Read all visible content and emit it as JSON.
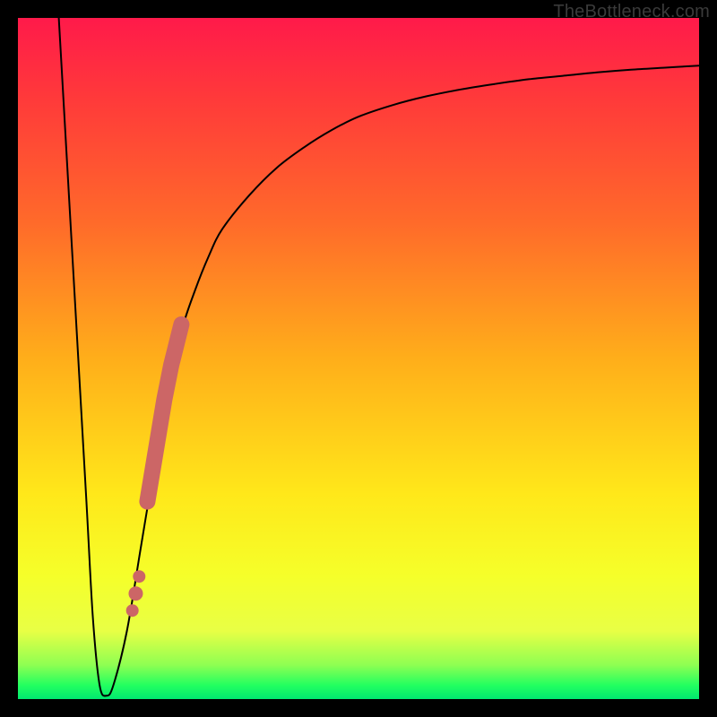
{
  "watermark": "TheBottleneck.com",
  "chart_data": {
    "type": "line",
    "title": "",
    "xlabel": "",
    "ylabel": "",
    "xlim": [
      0,
      100
    ],
    "ylim": [
      0,
      100
    ],
    "grid": false,
    "series": [
      {
        "name": "bottleneck-curve",
        "color": "#000000",
        "x": [
          6,
          8,
          10,
          11,
          12,
          13,
          14,
          16,
          18,
          20,
          22,
          24,
          26,
          28,
          30,
          34,
          38,
          42,
          46,
          50,
          55,
          60,
          65,
          70,
          75,
          80,
          85,
          90,
          95,
          100
        ],
        "y": [
          100,
          65,
          30,
          12,
          2,
          0.5,
          2,
          10,
          22,
          34,
          45,
          54,
          60,
          65,
          69,
          74,
          78,
          81,
          83.5,
          85.5,
          87.2,
          88.5,
          89.5,
          90.3,
          91,
          91.5,
          92,
          92.4,
          92.7,
          93
        ]
      }
    ],
    "overlay_marks": {
      "name": "highlight-segment",
      "color": "#cc6666",
      "x": [
        19.0,
        19.5,
        20.0,
        20.5,
        21.0,
        21.5,
        22.0,
        22.5,
        23.0,
        23.5,
        24.0,
        16.8,
        17.3,
        17.8
      ],
      "y": [
        29.0,
        32.0,
        35.0,
        38.0,
        41.0,
        44.0,
        46.5,
        49.0,
        51.0,
        53.0,
        55.0,
        13.0,
        15.5,
        18.0
      ]
    }
  }
}
